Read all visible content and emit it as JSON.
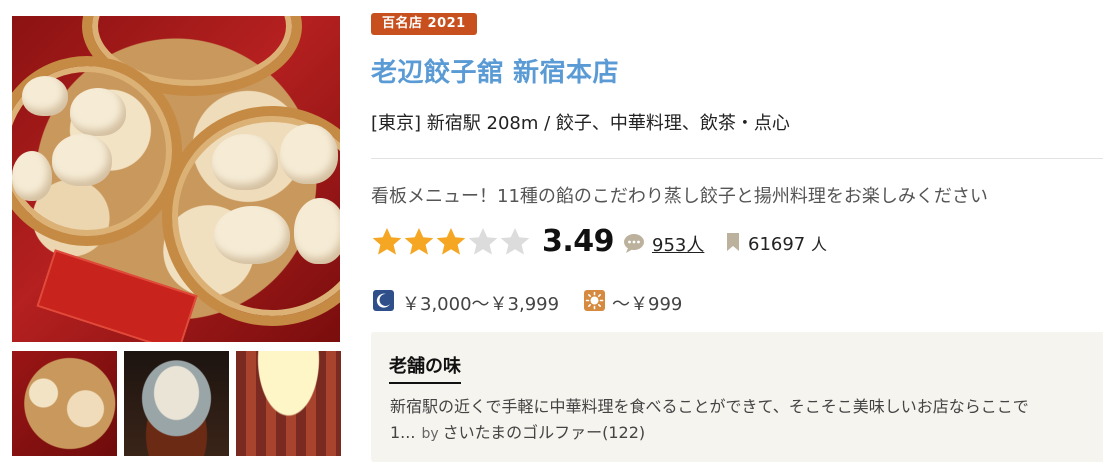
{
  "badge": {
    "label": "百名店 2021",
    "color": "#c8501f"
  },
  "restaurant": {
    "name": "老辺餃子舘 新宿本店",
    "area_line": "[東京] 新宿駅 208m / 餃子、中華料理、飲茶・点心",
    "catchphrase": "看板メニュー！11種の餡のこだわり蒸し餃子と揚州料理をお楽しみください"
  },
  "rating": {
    "value": 3.49,
    "score_text": "3.49",
    "stars_filled": 3,
    "stars_total": 5,
    "star_color": "#f5a623",
    "review_count": "953人",
    "save_count": "61697",
    "save_unit": "人"
  },
  "price": {
    "night_label": "￥3,000～￥3,999",
    "lunch_label": "～￥999",
    "night_icon": "moon-icon",
    "lunch_icon": "sun-icon"
  },
  "review": {
    "title": "老舗の味",
    "body_line1": "新宿駅の近くで手軽に中華料理を食べることができて、そこそこ美味しいお店ならここで",
    "body_line2": "1...",
    "by": "by",
    "author": "さいたまのゴルファー(122)"
  },
  "colors": {
    "link_blue": "#5b9bd5",
    "review_box_bg": "#f6f4ef"
  }
}
